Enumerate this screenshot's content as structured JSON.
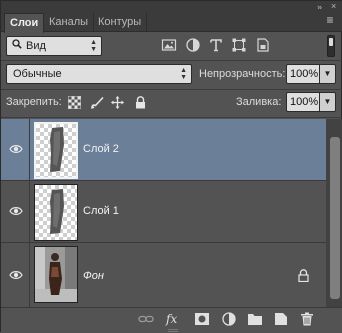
{
  "panel": {
    "tabs": [
      "Слои",
      "Каналы",
      "Контуры"
    ],
    "active_tab": "Слои",
    "collapse_glyph": "»",
    "close_glyph": "×",
    "menu_icon": "panel-menu-icon"
  },
  "filter": {
    "kind_label": "Вид",
    "icons": [
      "pixel-layer-filter-icon",
      "adjustment-layer-filter-icon",
      "type-layer-filter-icon",
      "shape-layer-filter-icon",
      "smart-object-filter-icon"
    ]
  },
  "blend": {
    "mode": "Обычные",
    "opacity_label": "Непрозрачность:",
    "opacity_value": "100%"
  },
  "lock": {
    "label": "Закрепить:",
    "icons": [
      "lock-transparent-pixels-icon",
      "lock-image-pixels-icon",
      "lock-position-icon",
      "lock-all-icon"
    ],
    "fill_label": "Заливка:",
    "fill_value": "100%"
  },
  "layers": [
    {
      "name": "Слой 2",
      "selected": true,
      "visible": true,
      "locked": false,
      "italic": false
    },
    {
      "name": "Слой 1",
      "selected": false,
      "visible": true,
      "locked": false,
      "italic": false
    },
    {
      "name": "Фон",
      "selected": false,
      "visible": true,
      "locked": true,
      "italic": true
    }
  ],
  "bottom_icons": [
    "link-layers-icon",
    "layer-style-fx-icon",
    "add-mask-icon",
    "new-adjustment-layer-icon",
    "new-group-icon",
    "new-layer-icon",
    "delete-layer-icon"
  ],
  "colors": {
    "panel_bg": "#535353",
    "selected_layer": "#6c7f99"
  }
}
